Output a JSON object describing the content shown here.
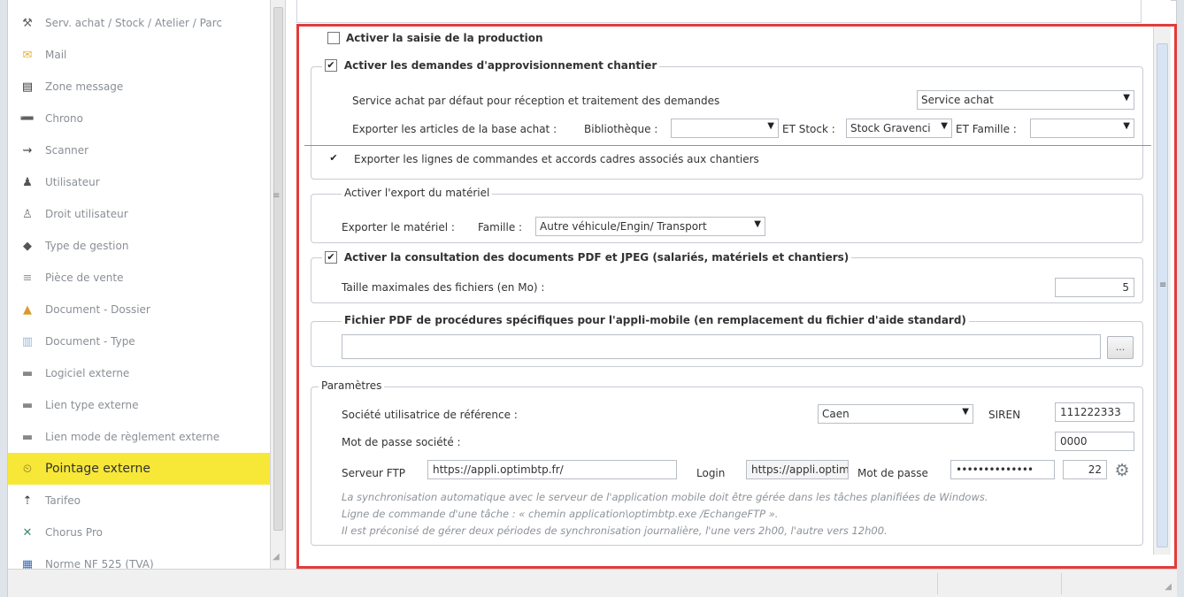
{
  "sidebar": {
    "items": [
      {
        "label": "Serv. achat / Stock / Atelier / Parc",
        "icon": "toolbox-icon",
        "glyph": "⚒",
        "color": "#666"
      },
      {
        "label": "Mail",
        "icon": "mail-icon",
        "glyph": "✉",
        "color": "#e8b22a"
      },
      {
        "label": "Zone message",
        "icon": "message-icon",
        "glyph": "▤",
        "color": "#333"
      },
      {
        "label": "Chrono",
        "icon": "chrono-icon",
        "glyph": "➖",
        "color": "#444"
      },
      {
        "label": "Scanner",
        "icon": "scanner-icon",
        "glyph": "⇝",
        "color": "#444"
      },
      {
        "label": "Utilisateur",
        "icon": "user-icon",
        "glyph": "♟",
        "color": "#555"
      },
      {
        "label": "Droit utilisateur",
        "icon": "user-rights-icon",
        "glyph": "♙",
        "color": "#777"
      },
      {
        "label": "Type de gestion",
        "icon": "management-type-icon",
        "glyph": "◆",
        "color": "#555"
      },
      {
        "label": "Pièce de vente",
        "icon": "sales-doc-icon",
        "glyph": "≡",
        "color": "#999"
      },
      {
        "label": "Document - Dossier",
        "icon": "folder-icon",
        "glyph": "▲",
        "color": "#d99a2b"
      },
      {
        "label": "Document - Type",
        "icon": "doc-type-icon",
        "glyph": "▥",
        "color": "#9db7d6"
      },
      {
        "label": "Logiciel externe",
        "icon": "software-icon",
        "glyph": "▬",
        "color": "#888"
      },
      {
        "label": "Lien type externe",
        "icon": "link-type-icon",
        "glyph": "▬",
        "color": "#888"
      },
      {
        "label": "Lien mode de règlement externe",
        "icon": "payment-link-icon",
        "glyph": "▬",
        "color": "#888"
      },
      {
        "label": "Pointage externe",
        "icon": "time-tracking-icon",
        "glyph": "⏲",
        "color": "#7a6a22"
      },
      {
        "label": "Tarifeo",
        "icon": "tarifeo-icon",
        "glyph": "⇡",
        "color": "#333"
      },
      {
        "label": "Chorus Pro",
        "icon": "chorus-icon",
        "glyph": "✕",
        "color": "#3a8a6a"
      },
      {
        "label": "Norme NF 525 (TVA)",
        "icon": "nf525-icon",
        "glyph": "▦",
        "color": "#3b6fb5"
      }
    ]
  },
  "form": {
    "production_label": "Activer la saisie de la production",
    "production_checked": false,
    "supply_label": "Activer les demandes d'approvisionnement chantier",
    "supply_checked": true,
    "service_label": "Service achat par défaut pour réception et traitement des demandes",
    "service_value": "Service achat",
    "export_articles_label": "Exporter les articles de la base achat :",
    "bibliotheque_label": "Bibliothèque :",
    "bibliotheque_value": "",
    "et_stock_label": "ET Stock :",
    "stock_value": "Stock Gravenci",
    "et_famille_label": "ET Famille :",
    "famille_value": "",
    "export_lines_label": "Exporter les lignes de commandes et accords cadres associés aux chantiers",
    "export_lines_checked": true,
    "material_legend": "Activer l'export du matériel",
    "export_material_label": "Exporter le matériel :",
    "famille_label": "Famille :",
    "material_famille_value": "Autre véhicule/Engin/ Transport",
    "pdf_label": "Activer la consultation des documents PDF et JPEG (salariés, matériels et chantiers)",
    "pdf_checked": true,
    "max_size_label": "Taille maximales des fichiers (en Mo) :",
    "max_size_value": "5",
    "pdf_file_legend": "Fichier PDF de procédures spécifiques pour l'appli-mobile (en remplacement du fichier d'aide standard)",
    "pdf_file_value": "",
    "browse_label": "...",
    "params_legend": "Paramètres",
    "company_label": "Société utilisatrice de référence :",
    "company_value": "Caen",
    "siren_label": "SIREN",
    "siren_value": "111222333",
    "company_pwd_label": "Mot de passe société :",
    "company_pwd_value": "0000",
    "ftp_label": "Serveur FTP",
    "ftp_value": "https://appli.optimbtp.fr/",
    "login_label": "Login",
    "login_value": "https://appli.optim",
    "pwd_label": "Mot de passe",
    "pwd_value": "••••••••••••••",
    "port_value": "22",
    "note_1": "La synchronisation automatique avec le serveur de l'application mobile doit être gérée dans les tâches planifiées de Windows.",
    "note_2": "Ligne de commande d'une tâche : « chemin application\\optimbtp.exe /EchangeFTP ».",
    "note_3": "Il est préconisé de gérer deux périodes de synchronisation journalière, l'une vers 2h00, l'autre vers 12h00."
  },
  "colors": {
    "highlight": "#e23b3b",
    "active_item": "#f7e838"
  }
}
